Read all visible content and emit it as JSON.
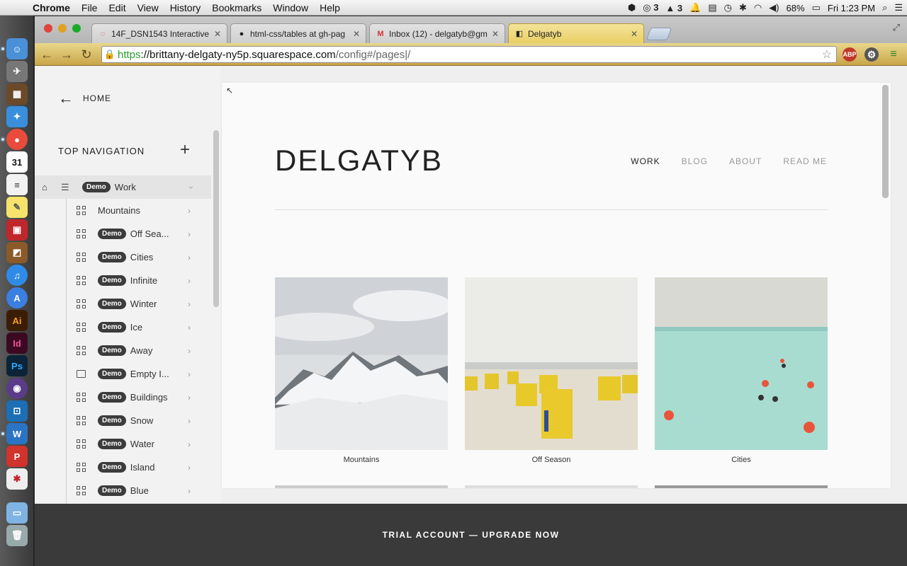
{
  "menubar": {
    "app": "Chrome",
    "items": [
      "File",
      "Edit",
      "View",
      "History",
      "Bookmarks",
      "Window",
      "Help"
    ],
    "badge_count_1": "3",
    "badge_count_2": "3",
    "battery": "68%",
    "clock": "Fri 1:23 PM"
  },
  "tabs": [
    {
      "title": "14F_DSN1543 Interactive D",
      "favicon": "loading-icon"
    },
    {
      "title": "html-css/tables at gh-pag",
      "favicon": "github-icon"
    },
    {
      "title": "Inbox (12) - delgatyb@gm",
      "favicon": "gmail-icon"
    },
    {
      "title": "Delgatyb",
      "favicon": "squarespace-icon"
    }
  ],
  "address": {
    "scheme": "https",
    "host": "://brittany-delgaty-ny5p.squarespace.com",
    "path": "/config#/pages|/"
  },
  "extensions": {
    "abp": "ABP"
  },
  "sidebar": {
    "home_label": "HOME",
    "section_title": "TOP NAVIGATION",
    "top_item": {
      "badge": "Demo",
      "label": "Work"
    },
    "items": [
      {
        "badge": "",
        "label": "Mountains",
        "type": "gallery"
      },
      {
        "badge": "Demo",
        "label": "Off Sea...",
        "type": "gallery"
      },
      {
        "badge": "Demo",
        "label": "Cities",
        "type": "gallery"
      },
      {
        "badge": "Demo",
        "label": "Infinite",
        "type": "gallery"
      },
      {
        "badge": "Demo",
        "label": "Winter",
        "type": "gallery"
      },
      {
        "badge": "Demo",
        "label": "Ice",
        "type": "gallery"
      },
      {
        "badge": "Demo",
        "label": "Away",
        "type": "gallery"
      },
      {
        "badge": "Demo",
        "label": "Empty I...",
        "type": "page"
      },
      {
        "badge": "Demo",
        "label": "Buildings",
        "type": "gallery"
      },
      {
        "badge": "Demo",
        "label": "Snow",
        "type": "gallery"
      },
      {
        "badge": "Demo",
        "label": "Water",
        "type": "gallery"
      },
      {
        "badge": "Demo",
        "label": "Island",
        "type": "gallery"
      },
      {
        "badge": "Demo",
        "label": "Blue",
        "type": "gallery"
      }
    ]
  },
  "site": {
    "title": "DELGATYB",
    "nav": [
      "WORK",
      "BLOG",
      "ABOUT",
      "READ ME"
    ],
    "thumbnails": [
      {
        "caption": "Mountains"
      },
      {
        "caption": "Off Season"
      },
      {
        "caption": "Cities"
      }
    ]
  },
  "trial_bar": "TRIAL ACCOUNT — UPGRADE NOW",
  "colors": {
    "demo_badge": "#3c3c3c",
    "trial_bar": "#3a3a3a",
    "omnibox_secure": "#2a9d2a"
  }
}
